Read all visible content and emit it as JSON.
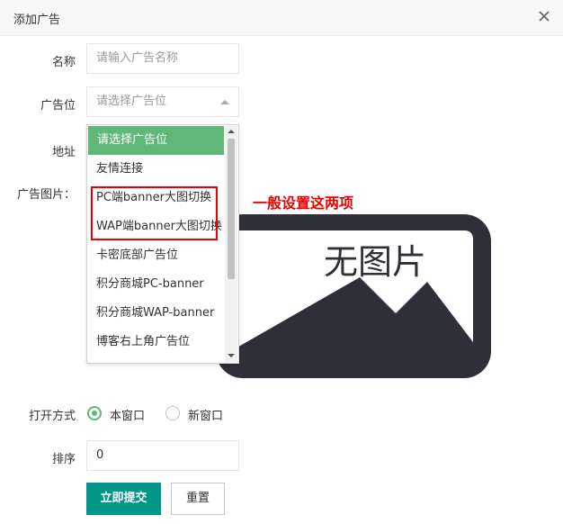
{
  "dialog": {
    "title": "添加广告",
    "close_icon": "close-icon"
  },
  "form": {
    "name_label": "名称",
    "name_placeholder": "请输入广告名称",
    "position_label": "广告位",
    "position_selected": "请选择广告位",
    "address_label": "地址",
    "image_label": "广告图片：",
    "no_image_text": "无图片",
    "open_label": "打开方式",
    "open_options": [
      "本窗口",
      "新窗口"
    ],
    "open_selected": "本窗口",
    "sort_label": "排序",
    "sort_value": "0",
    "submit_label": "立即提交",
    "reset_label": "重置"
  },
  "dropdown": {
    "options": [
      "请选择广告位",
      "友情连接",
      "PC端banner大图切换",
      "WAP端banner大图切换",
      "卡密底部广告位",
      "积分商城PC-banner",
      "积分商城WAP-banner",
      "博客右上角广告位"
    ],
    "highlighted": "请选择广告位"
  },
  "annotation": {
    "text": "一般设置这两项"
  },
  "colors": {
    "accent": "#5fb878",
    "primary_button": "#009688",
    "annotation": "#ee0000",
    "placeholder_art": "#2f2f3a"
  }
}
